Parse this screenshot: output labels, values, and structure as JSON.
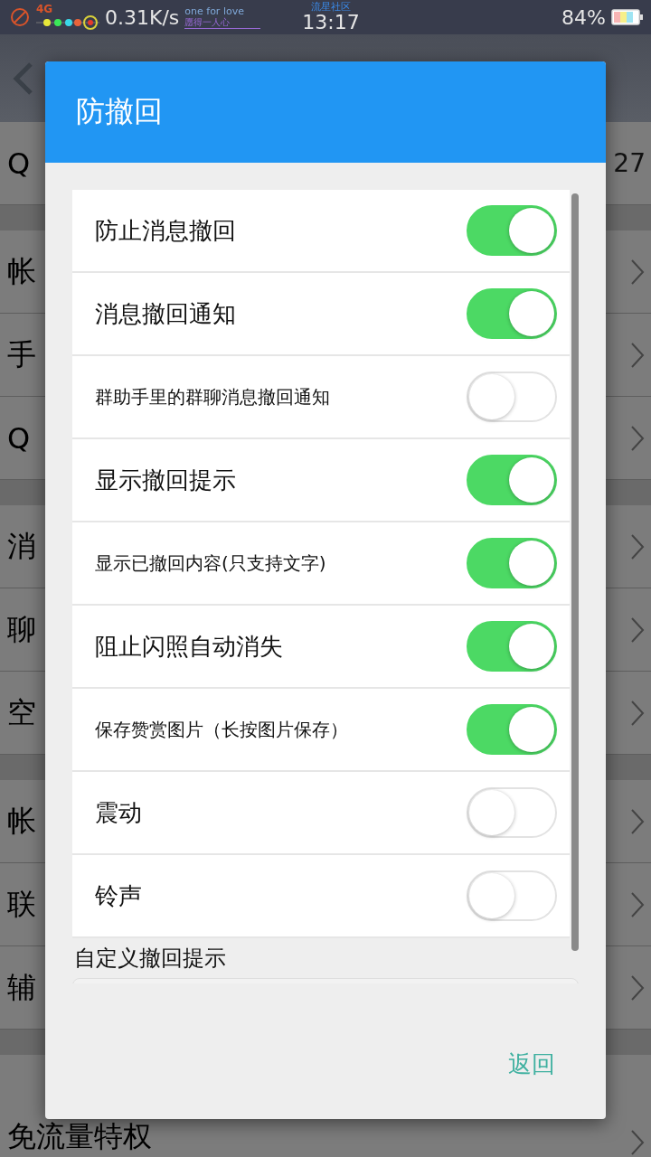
{
  "status_bar": {
    "network": "4G",
    "speed": "0.31K/s",
    "deco_top": "one for love",
    "deco_bottom": "愿得一人心",
    "carrier_tag": "流星社区",
    "time": "13:17",
    "battery": "84%"
  },
  "background": {
    "groups": [
      [
        {
          "label": "Q",
          "value": "27"
        }
      ],
      [
        {
          "label": "帐"
        },
        {
          "label": "手"
        },
        {
          "label": "Q"
        }
      ],
      [
        {
          "label": "消"
        },
        {
          "label": "聊"
        },
        {
          "label": "空"
        }
      ],
      [
        {
          "label": "帐"
        },
        {
          "label": "联"
        },
        {
          "label": "辅"
        }
      ],
      [
        {
          "label": "免流量特权"
        }
      ]
    ]
  },
  "dialog": {
    "title": "防撤回",
    "options": [
      {
        "label": "防止消息撤回",
        "compact": false,
        "on": true
      },
      {
        "label": "消息撤回通知",
        "compact": false,
        "on": true
      },
      {
        "label": "群助手里的群聊消息撤回通知",
        "compact": true,
        "on": false
      },
      {
        "label": "显示撤回提示",
        "compact": false,
        "on": true
      },
      {
        "label": "显示已撤回内容(只支持文字)",
        "compact": true,
        "on": true
      },
      {
        "label": "阻止闪照自动消失",
        "compact": false,
        "on": true
      },
      {
        "label": "保存赞赏图片（长按图片保存）",
        "compact": true,
        "on": true
      },
      {
        "label": "震动",
        "compact": false,
        "on": false
      },
      {
        "label": "铃声",
        "compact": false,
        "on": false
      }
    ],
    "custom_label": "自定义撤回提示",
    "button": "返回"
  }
}
